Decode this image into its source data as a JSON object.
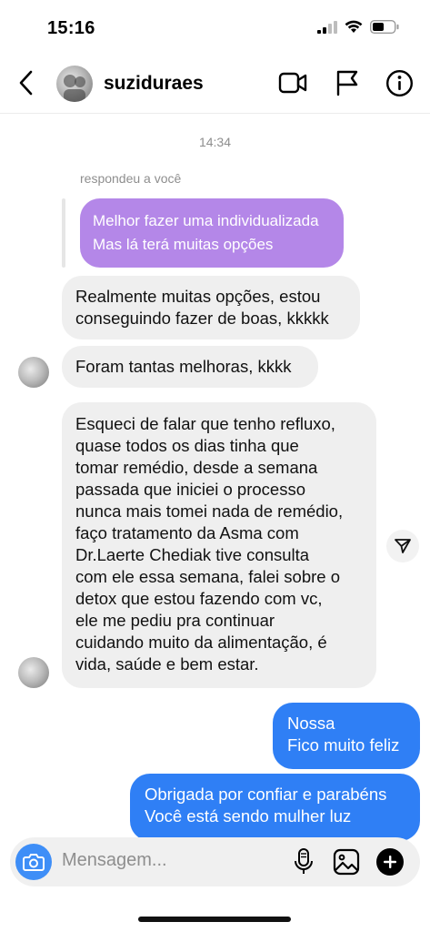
{
  "status_bar": {
    "time": "15:16"
  },
  "header": {
    "username": "suziduraes"
  },
  "conversation": {
    "timestamp": "14:34",
    "reply_label": "respondeu a você",
    "quoted_message": [
      "Melhor fazer uma individualizada",
      "Mas lá terá muitas opções"
    ],
    "messages_in": [
      {
        "lines": [
          "Realmente muitas opções, estou",
          "conseguindo fazer de boas, kkkkk"
        ]
      },
      {
        "lines": [
          "Foram tantas melhoras, kkkk"
        ]
      },
      {
        "lines": [
          "Esqueci de falar que tenho refluxo,",
          "quase todos os dias tinha que",
          "tomar remédio, desde a semana",
          "passada que iniciei o processo",
          "nunca mais tomei nada de remédio,",
          "faço tratamento da Asma  com",
          "Dr.Laerte Chediak tive consulta",
          "com ele essa semana, falei sobre o",
          "detox que estou fazendo com vc,",
          "ele me pediu pra continuar",
          "cuidando muito da alimentação, é",
          "vida, saúde e bem estar."
        ]
      }
    ],
    "messages_out": [
      {
        "lines": [
          "Nossa",
          "Fico muito feliz"
        ]
      },
      {
        "lines": [
          "Obrigada por confiar e parabéns",
          "Você está sendo mulher luz"
        ]
      }
    ]
  },
  "composer": {
    "placeholder": "Mensagem..."
  },
  "icons": {
    "back": "chevron-left-icon",
    "video": "video-camera-icon",
    "flag": "flag-icon",
    "info": "info-icon",
    "share": "send-icon",
    "camera": "camera-icon",
    "mic": "microphone-icon",
    "gallery": "image-icon",
    "add": "plus-icon"
  },
  "colors": {
    "outgoing_bubble": "#2f7ff5",
    "quoted_bubble": "#b487e8",
    "incoming_bubble": "#efefef",
    "camera_button": "#3e8ef7"
  }
}
